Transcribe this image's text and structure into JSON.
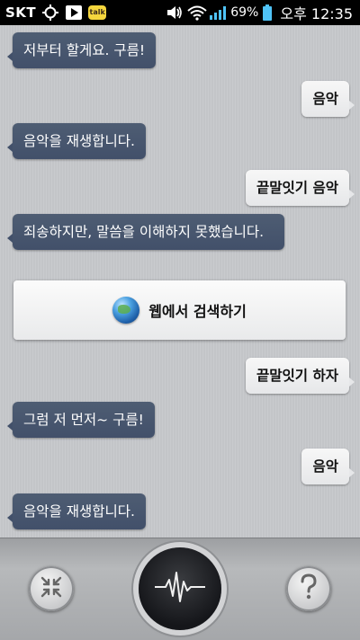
{
  "status_bar": {
    "carrier": "SKT",
    "battery_percent": "69%",
    "time": "오후 12:35",
    "notification_icons": [
      "gps-icon",
      "play-store-icon",
      "kakaotalk-icon"
    ],
    "system_icons": [
      "volume-icon",
      "wifi-icon",
      "signal-icon",
      "battery-icon"
    ],
    "kakao_label": "talk"
  },
  "chat": {
    "messages": [
      {
        "sender": "system",
        "text": "저부터 할게요. 구름!"
      },
      {
        "sender": "user",
        "text": "음악"
      },
      {
        "sender": "system",
        "text": "음악을 재생합니다."
      },
      {
        "sender": "user",
        "text": "끝말잇기 음악"
      },
      {
        "sender": "system",
        "text": "죄송하지만, 말씀을 이해하지 못했습니다."
      },
      {
        "sender": "user",
        "text": "끝말잇기 하자"
      },
      {
        "sender": "system",
        "text": "그럼 저 먼저~ 구름!"
      },
      {
        "sender": "user",
        "text": "음악"
      },
      {
        "sender": "system",
        "text": "음악을 재생합니다."
      }
    ],
    "web_search_button": {
      "label": "웹에서 검색하기",
      "icon": "globe-icon"
    }
  },
  "bottom_bar": {
    "left_button_icon": "minimize-icon",
    "center_button_icon": "voice-waveform-icon",
    "right_button_icon": "help-icon"
  },
  "colors": {
    "system_bubble": "#4a586e",
    "user_bubble": "#f2f2f3",
    "background": "#c6c8cb",
    "status_bar": "#000000"
  }
}
